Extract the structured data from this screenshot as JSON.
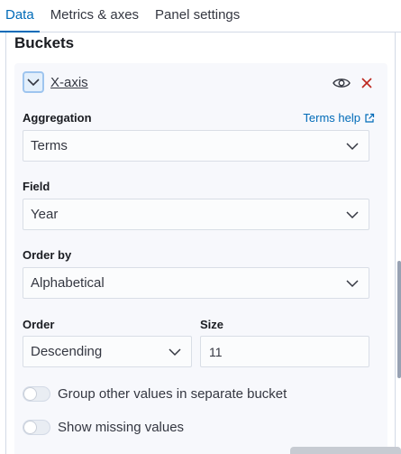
{
  "tabs": [
    {
      "label": "Data",
      "active": true
    },
    {
      "label": "Metrics & axes",
      "active": false
    },
    {
      "label": "Panel settings",
      "active": false
    }
  ],
  "section": {
    "title": "Buckets"
  },
  "bucket": {
    "name": "X-axis",
    "icons": {
      "toggle": "chevron-down-icon",
      "visibility": "eye-icon",
      "remove": "close-icon"
    },
    "aggregation": {
      "label": "Aggregation",
      "help_link": "Terms help",
      "value": "Terms"
    },
    "field": {
      "label": "Field",
      "value": "Year"
    },
    "order_by": {
      "label": "Order by",
      "value": "Alphabetical"
    },
    "order": {
      "label": "Order",
      "value": "Descending"
    },
    "size": {
      "label": "Size",
      "value": "11"
    },
    "switches": [
      {
        "label": "Group other values in separate bucket",
        "checked": false
      },
      {
        "label": "Show missing values",
        "checked": false
      }
    ]
  },
  "colors": {
    "accent": "#006bb8",
    "danger": "#bd271e",
    "panel_bg": "#f7f8fc"
  }
}
